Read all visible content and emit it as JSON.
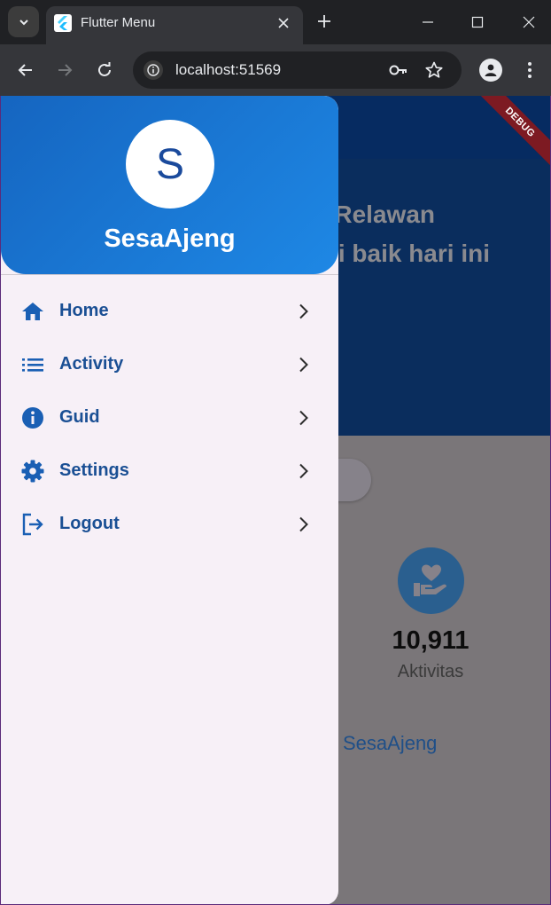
{
  "browser": {
    "tab_title": "Flutter Menu",
    "url": "localhost:51569",
    "favicon": "flutter-icon",
    "colors": {
      "chrome_dark": "#202124",
      "chrome_toolbar": "#35363a"
    }
  },
  "app": {
    "debug_banner": "DEBUG",
    "hero": {
      "line1": "Relawan",
      "line2": "i baik hari ini"
    },
    "stat": {
      "icon": "hand-heart-icon",
      "value": "10,911",
      "label": "Aktivitas"
    },
    "username_link": "SesaAjeng"
  },
  "drawer": {
    "avatar_initial": "S",
    "user_name": "SesaAjeng",
    "colors": {
      "accent": "#1a4f94",
      "header_start": "#1565c0",
      "header_end": "#1e88e5"
    },
    "items": [
      {
        "label": "Home",
        "icon": "home-icon"
      },
      {
        "label": "Activity",
        "icon": "list-icon"
      },
      {
        "label": "Guid",
        "icon": "info-icon"
      },
      {
        "label": "Settings",
        "icon": "gear-icon"
      },
      {
        "label": "Logout",
        "icon": "logout-icon"
      }
    ]
  }
}
